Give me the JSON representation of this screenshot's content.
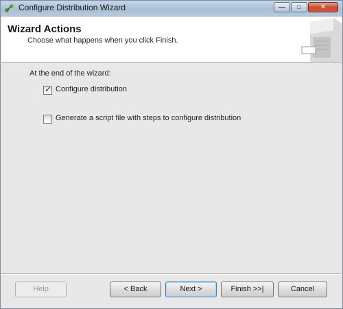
{
  "window": {
    "title": "Configure Distribution Wizard"
  },
  "header": {
    "title": "Wizard Actions",
    "subtitle": "Choose what happens when you click Finish."
  },
  "content": {
    "prompt": "At the end of the wizard:",
    "options": [
      {
        "label": "Configure distribution",
        "checked": true
      },
      {
        "label": "Generate a script file with steps to configure distribution",
        "checked": false
      }
    ]
  },
  "buttons": {
    "help": "Help",
    "back": "< Back",
    "next": "Next >",
    "finish": "Finish >>|",
    "cancel": "Cancel"
  },
  "icons": {
    "app": "wizard-app-icon",
    "check": "checkmark-icon"
  },
  "colors": {
    "titlebar": "#b6c9db",
    "close_button": "#c54a32",
    "dialog_background": "#e8e8e8",
    "header_background": "#ffffff"
  }
}
